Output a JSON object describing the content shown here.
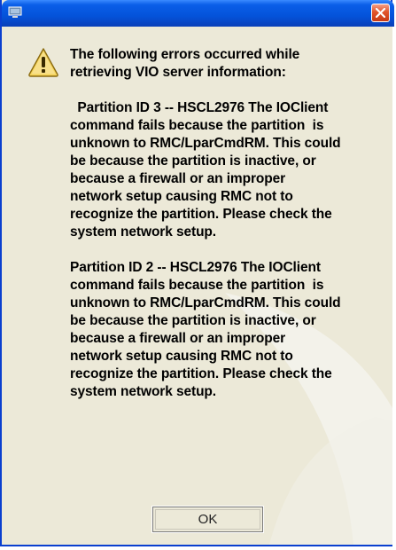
{
  "dialog": {
    "title": "",
    "message": {
      "heading": [
        "The following errors occurred while",
        "retrieving VIO server information:"
      ],
      "paragraphs": [
        [
          "  Partition ID 3 -- HSCL2976 The IOClient",
          "command fails because the partition  is",
          "unknown to RMC/LparCmdRM. This could",
          "be because the partition is inactive, or",
          "because a firewall or an improper",
          "network setup causing RMC not to",
          "recognize the partition. Please check the",
          "system network setup."
        ],
        [
          "Partition ID 2 -- HSCL2976 The IOClient",
          "command fails because the partition  is",
          "unknown to RMC/LparCmdRM. This could",
          "be because the partition is inactive, or",
          "because a firewall or an improper",
          "network setup causing RMC not to",
          "recognize the partition. Please check the",
          "system network setup."
        ]
      ]
    },
    "ok_label": "OK",
    "icons": {
      "window": "monitor-icon",
      "close": "close-icon",
      "message": "warning-icon"
    },
    "colors": {
      "titlebar": "#0453da",
      "close": "#e0542b",
      "warning": "#f5d45a"
    }
  }
}
